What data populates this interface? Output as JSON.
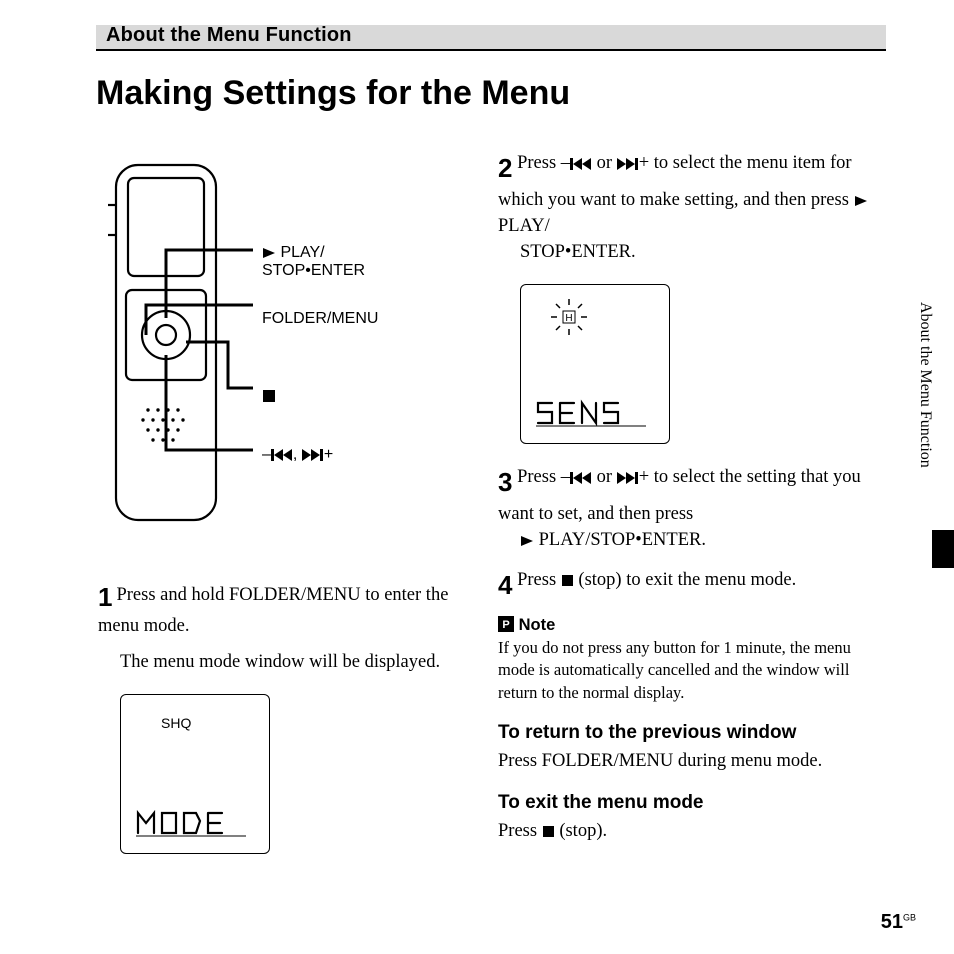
{
  "header": {
    "section_title": "About the Menu Function"
  },
  "title": "Making Settings for the Menu",
  "device_callouts": {
    "play_line1": "PLAY/",
    "play_line2": "STOP•ENTER",
    "folder_menu": "FOLDER/MENU",
    "nav": ","
  },
  "steps": {
    "s1": {
      "num": "1",
      "text1": "Press and hold FOLDER/MENU to enter the menu mode.",
      "text2": "The menu mode window will be displayed."
    },
    "s2": {
      "num": "2",
      "text_a": "Press –",
      "text_b": " or ",
      "text_c": "+ to select the menu item for which you want to make setting, and then press ",
      "text_d": " PLAY/",
      "text_e": "STOP•ENTER."
    },
    "s3": {
      "num": "3",
      "text_a": "Press –",
      "text_b": " or ",
      "text_c": "+ to select the setting that you want to set, and then press ",
      "text_d": " PLAY/STOP•ENTER."
    },
    "s4": {
      "num": "4",
      "text_a": "Press ",
      "text_b": " (stop) to exit the menu mode."
    }
  },
  "lcd": {
    "shq": "SHQ",
    "mode_seg": "MODE",
    "sens_seg": "SENS",
    "h_label": "H"
  },
  "note": {
    "label": "Note",
    "body": "If you do not press any button for 1 minute, the menu mode is automatically cancelled and the window will return to the normal display."
  },
  "return_prev": {
    "head": "To return to the previous window",
    "body": "Press FOLDER/MENU during menu mode."
  },
  "exit_mode": {
    "head": "To exit the menu mode",
    "body_a": "Press ",
    "body_b": " (stop)."
  },
  "side_tab": "About the Menu Function",
  "page_number": "51",
  "page_region": "GB"
}
